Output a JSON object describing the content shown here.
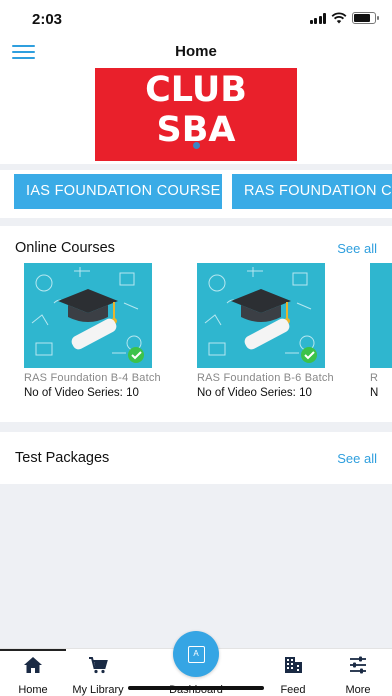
{
  "status_bar": {
    "time": "2:03"
  },
  "header": {
    "title": "Home"
  },
  "banner": {
    "line1": "CLUB",
    "line2": "SBA"
  },
  "chips": [
    "IAS FOUNDATION COURSE",
    "RAS FOUNDATION C"
  ],
  "online_courses": {
    "title": "Online Courses",
    "see_all": "See all",
    "cards": [
      {
        "title": "RAS Foundation B-4 Batch",
        "meta": "No of Video Series: 10"
      },
      {
        "title": "RAS Foundation B-6 Batch",
        "meta": "No of Video Series: 10"
      },
      {
        "title": "R",
        "meta": "N"
      }
    ]
  },
  "test_packages": {
    "title": "Test Packages",
    "see_all": "See all"
  },
  "tabbar": {
    "home": "Home",
    "library": "My Library",
    "dashboard": "Dashboard",
    "feed": "Feed",
    "more": "More"
  },
  "colors": {
    "accent": "#2f9fde",
    "chip": "#3aabe6",
    "banner": "#e9202b",
    "thumb": "#2fb6cf",
    "check": "#3cc24a"
  }
}
